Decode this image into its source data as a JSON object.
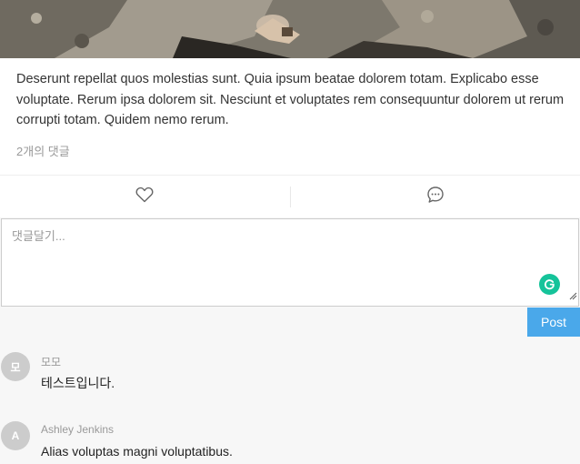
{
  "post": {
    "body": "Deserunt repellat quos molestias sunt. Quia ipsum beatae dolorem totam. Explicabo esse voluptate. Rerum ipsa dolorem sit. Nesciunt et voluptates rem consequuntur dolorem ut rerum corrupti totam. Quidem nemo rerum.",
    "comment_count_label": "2개의 댓글"
  },
  "actions": {
    "like_icon": "heart-icon",
    "comment_icon": "speech-bubble-icon"
  },
  "comment_form": {
    "placeholder": "댓글달기...",
    "value": "",
    "post_label": "Post"
  },
  "comments": [
    {
      "avatar_initial": "모",
      "author": "모모",
      "text": "테스트입니다."
    },
    {
      "avatar_initial": "A",
      "author": "Ashley Jenkins",
      "text": "Alias voluptas magni voluptatibus."
    }
  ],
  "colors": {
    "accent": "#4aa8ea",
    "grammarly": "#15c39a",
    "page_bg": "#f7f7f7"
  }
}
